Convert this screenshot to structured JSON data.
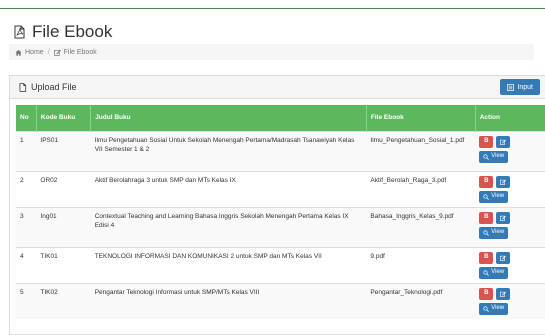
{
  "page": {
    "title": "File Ebook"
  },
  "breadcrumb": {
    "home": "Home",
    "current": "File Ebook"
  },
  "panel": {
    "heading": "Upload File",
    "input_button": "Input"
  },
  "table": {
    "headers": {
      "no": "No",
      "kode": "Kode Buku",
      "judul": "Judul Buku",
      "file": "File Ebook",
      "action": "Action"
    },
    "rows": [
      {
        "no": "1",
        "kode": "IPS01",
        "judul": "Ilmu Pengetahuan Sosial Untuk Sekolah Menengah Pertama/Madrasah Tsanawiyah Kelas VII Semester 1 & 2",
        "file": "Ilmu_Pengetahuan_Sosial_1.pdf"
      },
      {
        "no": "2",
        "kode": "OR02",
        "judul": "Aktif Berolahraga 3 untuk SMP dan MTs Kelas IX",
        "file": "Aktif_Berolah_Raga_3.pdf"
      },
      {
        "no": "3",
        "kode": "Ing01",
        "judul": "Contextual Teaching and Learning Bahasa Inggris Sekolah Menengah Pertama Kelas IX Edisi 4",
        "file": "Bahasa_Inggris_Kelas_9.pdf"
      },
      {
        "no": "4",
        "kode": "TIK01",
        "judul": "TEKNOLOGI INFORMASI DAN KOMUNIKASI 2 untuk SMP dan MTs Kelas VII",
        "file": "9.pdf"
      },
      {
        "no": "5",
        "kode": "TIK02",
        "judul": "Pengantar Teknologi Informasi untuk SMP/MTs Kelas VIII",
        "file": "Pengantar_Teknologi.pdf"
      }
    ],
    "action_labels": {
      "delete": "B",
      "view": "View"
    }
  },
  "colors": {
    "header_green": "#5cb85c",
    "primary_blue": "#337ab7",
    "danger_red": "#d9534f"
  },
  "icons": {
    "title": "file-pdf-icon",
    "home": "home-icon",
    "crumb": "edit-icon",
    "panel": "file-pdf-icon",
    "input": "list-icon",
    "edit": "edit-icon",
    "view": "search-icon"
  }
}
